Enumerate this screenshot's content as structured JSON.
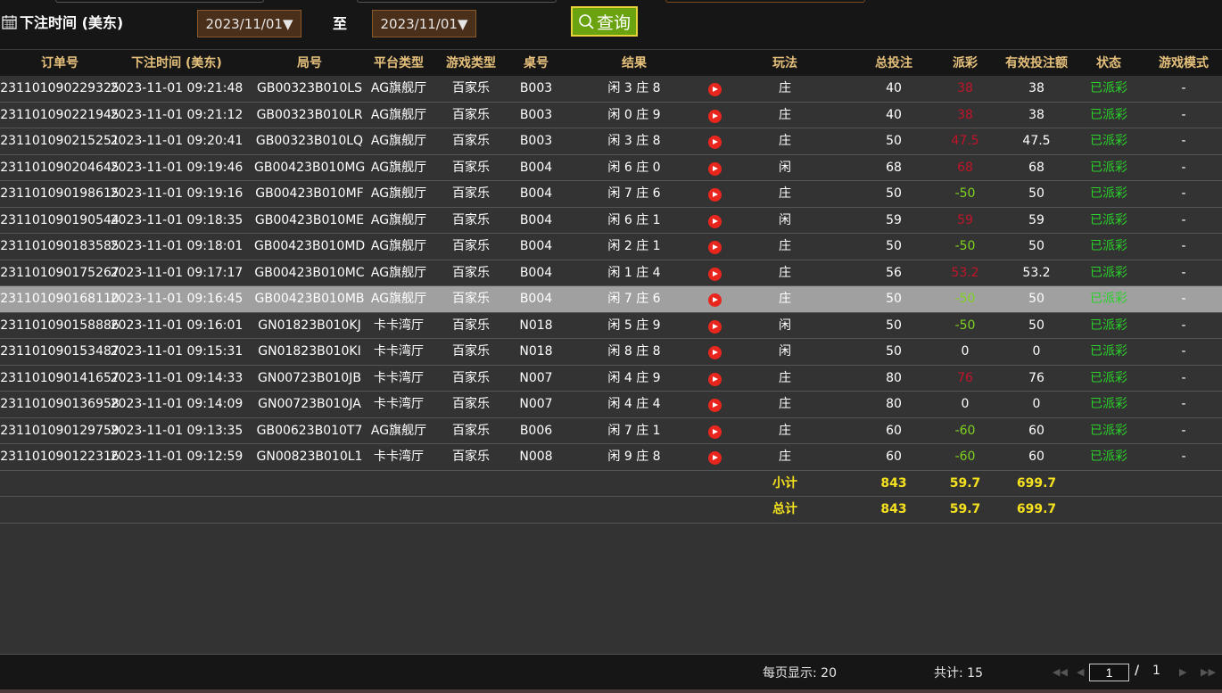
{
  "filter": {
    "date_label": "下注时间 (美东)",
    "start_date": "2023/11/01",
    "to_label": "至",
    "end_date": "2023/11/01",
    "query_label": "查询",
    "dropdown_arrow": "▼"
  },
  "columns": [
    "订单号",
    "下注时间 (美东)",
    "局号",
    "平台类型",
    "游戏类型",
    "桌号",
    "结果",
    "玩法",
    "总投注",
    "派彩",
    "有效投注额",
    "状态",
    "游戏模式"
  ],
  "rows": [
    {
      "order": "231101090229325",
      "time": "2023-11-01 09:21:48",
      "round": "GB00323B010LS",
      "platform": "AG旗舰厅",
      "game": "百家乐",
      "table": "B003",
      "result": "闲 3 庄 8",
      "bet_type": "庄",
      "total": "40",
      "payout": "38",
      "payout_color": "red",
      "valid": "38",
      "status": "已派彩",
      "mode": "-"
    },
    {
      "order": "231101090221945",
      "time": "2023-11-01 09:21:12",
      "round": "GB00323B010LR",
      "platform": "AG旗舰厅",
      "game": "百家乐",
      "table": "B003",
      "result": "闲 0 庄 9",
      "bet_type": "庄",
      "total": "40",
      "payout": "38",
      "payout_color": "red",
      "valid": "38",
      "status": "已派彩",
      "mode": "-"
    },
    {
      "order": "231101090215251",
      "time": "2023-11-01 09:20:41",
      "round": "GB00323B010LQ",
      "platform": "AG旗舰厅",
      "game": "百家乐",
      "table": "B003",
      "result": "闲 3 庄 8",
      "bet_type": "庄",
      "total": "50",
      "payout": "47.5",
      "payout_color": "red",
      "valid": "47.5",
      "status": "已派彩",
      "mode": "-"
    },
    {
      "order": "231101090204645",
      "time": "2023-11-01 09:19:46",
      "round": "GB00423B010MG",
      "platform": "AG旗舰厅",
      "game": "百家乐",
      "table": "B004",
      "result": "闲 6 庄 0",
      "bet_type": "闲",
      "total": "68",
      "payout": "68",
      "payout_color": "red",
      "valid": "68",
      "status": "已派彩",
      "mode": "-"
    },
    {
      "order": "231101090198615",
      "time": "2023-11-01 09:19:16",
      "round": "GB00423B010MF",
      "platform": "AG旗舰厅",
      "game": "百家乐",
      "table": "B004",
      "result": "闲 7 庄 6",
      "bet_type": "庄",
      "total": "50",
      "payout": "-50",
      "payout_color": "green",
      "valid": "50",
      "status": "已派彩",
      "mode": "-"
    },
    {
      "order": "231101090190544",
      "time": "2023-11-01 09:18:35",
      "round": "GB00423B010ME",
      "platform": "AG旗舰厅",
      "game": "百家乐",
      "table": "B004",
      "result": "闲 6 庄 1",
      "bet_type": "闲",
      "total": "59",
      "payout": "59",
      "payout_color": "red",
      "valid": "59",
      "status": "已派彩",
      "mode": "-"
    },
    {
      "order": "231101090183585",
      "time": "2023-11-01 09:18:01",
      "round": "GB00423B010MD",
      "platform": "AG旗舰厅",
      "game": "百家乐",
      "table": "B004",
      "result": "闲 2 庄 1",
      "bet_type": "庄",
      "total": "50",
      "payout": "-50",
      "payout_color": "green",
      "valid": "50",
      "status": "已派彩",
      "mode": "-"
    },
    {
      "order": "231101090175267",
      "time": "2023-11-01 09:17:17",
      "round": "GB00423B010MC",
      "platform": "AG旗舰厅",
      "game": "百家乐",
      "table": "B004",
      "result": "闲 1 庄 4",
      "bet_type": "庄",
      "total": "56",
      "payout": "53.2",
      "payout_color": "red",
      "valid": "53.2",
      "status": "已派彩",
      "mode": "-"
    },
    {
      "order": "231101090168110",
      "time": "2023-11-01 09:16:45",
      "round": "GB00423B010MB",
      "platform": "AG旗舰厅",
      "game": "百家乐",
      "table": "B004",
      "result": "闲 7 庄 6",
      "bet_type": "庄",
      "total": "50",
      "payout": "-50",
      "payout_color": "green",
      "valid": "50",
      "status": "已派彩",
      "mode": "-",
      "highlighted": true
    },
    {
      "order": "231101090158886",
      "time": "2023-11-01 09:16:01",
      "round": "GN01823B010KJ",
      "platform": "卡卡湾厅",
      "game": "百家乐",
      "table": "N018",
      "result": "闲 5 庄 9",
      "bet_type": "闲",
      "total": "50",
      "payout": "-50",
      "payout_color": "green",
      "valid": "50",
      "status": "已派彩",
      "mode": "-"
    },
    {
      "order": "231101090153487",
      "time": "2023-11-01 09:15:31",
      "round": "GN01823B010KI",
      "platform": "卡卡湾厅",
      "game": "百家乐",
      "table": "N018",
      "result": "闲 8 庄 8",
      "bet_type": "闲",
      "total": "50",
      "payout": "0",
      "payout_color": "white",
      "valid": "0",
      "status": "已派彩",
      "mode": "-"
    },
    {
      "order": "231101090141657",
      "time": "2023-11-01 09:14:33",
      "round": "GN00723B010JB",
      "platform": "卡卡湾厅",
      "game": "百家乐",
      "table": "N007",
      "result": "闲 4 庄 9",
      "bet_type": "庄",
      "total": "80",
      "payout": "76",
      "payout_color": "red",
      "valid": "76",
      "status": "已派彩",
      "mode": "-"
    },
    {
      "order": "231101090136958",
      "time": "2023-11-01 09:14:09",
      "round": "GN00723B010JA",
      "platform": "卡卡湾厅",
      "game": "百家乐",
      "table": "N007",
      "result": "闲 4 庄 4",
      "bet_type": "庄",
      "total": "80",
      "payout": "0",
      "payout_color": "white",
      "valid": "0",
      "status": "已派彩",
      "mode": "-"
    },
    {
      "order": "231101090129759",
      "time": "2023-11-01 09:13:35",
      "round": "GB00623B010T7",
      "platform": "AG旗舰厅",
      "game": "百家乐",
      "table": "B006",
      "result": "闲 7 庄 1",
      "bet_type": "庄",
      "total": "60",
      "payout": "-60",
      "payout_color": "green",
      "valid": "60",
      "status": "已派彩",
      "mode": "-"
    },
    {
      "order": "231101090122316",
      "time": "2023-11-01 09:12:59",
      "round": "GN00823B010L1",
      "platform": "卡卡湾厅",
      "game": "百家乐",
      "table": "N008",
      "result": "闲 9 庄 8",
      "bet_type": "庄",
      "total": "60",
      "payout": "-60",
      "payout_color": "green",
      "valid": "60",
      "status": "已派彩",
      "mode": "-"
    }
  ],
  "summary": {
    "subtotal": {
      "label": "小计",
      "total": "843",
      "payout": "59.7",
      "valid": "699.7"
    },
    "grand_total": {
      "label": "总计",
      "total": "843",
      "payout": "59.7",
      "valid": "699.7"
    }
  },
  "pagination": {
    "per_page_label": "每页显示: 20",
    "count_label": "共计: 15",
    "current_page": "1",
    "separator": "/",
    "total_pages": "1",
    "first_icon": "◀◀",
    "prev_icon": "◀",
    "next_icon": "▶",
    "last_icon": "▶▶"
  },
  "colors": {
    "accent_header": "#e5c07b",
    "status_green": "#2ad12a",
    "payout_red": "#c0142a",
    "payout_green": "#7ed321",
    "summary_yellow": "#f5e11e",
    "query_button": "#6aa30f",
    "date_select": "#4a2f1a"
  },
  "icons": {
    "calendar": "calendar-icon",
    "search": "search-icon",
    "play": "play-icon"
  }
}
